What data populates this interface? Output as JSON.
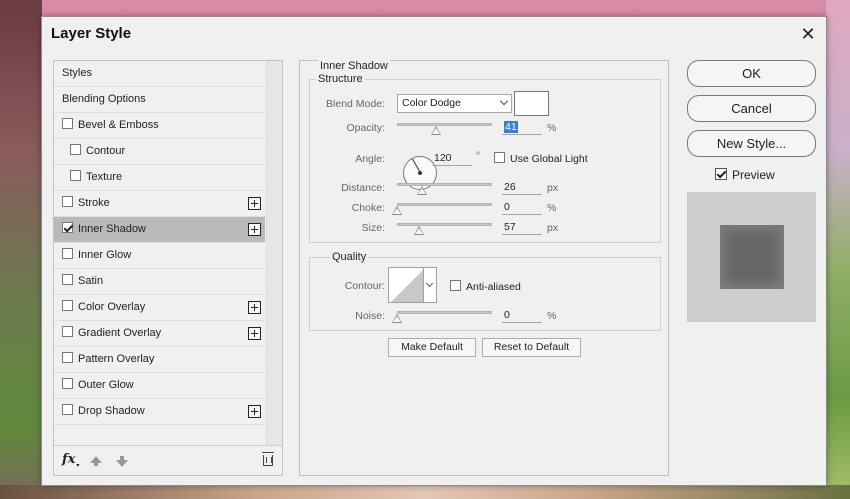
{
  "dialog": {
    "title": "Layer Style",
    "close_symbol": "✕"
  },
  "styles_panel": {
    "items": [
      {
        "label": "Styles",
        "checkbox": false
      },
      {
        "label": "Blending Options",
        "checkbox": false
      },
      {
        "label": "Bevel & Emboss",
        "checkbox": true,
        "checked": false
      },
      {
        "label": "Contour",
        "checkbox": true,
        "checked": false,
        "indent": true
      },
      {
        "label": "Texture",
        "checkbox": true,
        "checked": false,
        "indent": true
      },
      {
        "label": "Stroke",
        "checkbox": true,
        "checked": false,
        "plus": true
      },
      {
        "label": "Inner Shadow",
        "checkbox": true,
        "checked": true,
        "plus": true,
        "selected": true
      },
      {
        "label": "Inner Glow",
        "checkbox": true,
        "checked": false
      },
      {
        "label": "Satin",
        "checkbox": true,
        "checked": false
      },
      {
        "label": "Color Overlay",
        "checkbox": true,
        "checked": false,
        "plus": true
      },
      {
        "label": "Gradient Overlay",
        "checkbox": true,
        "checked": false,
        "plus": true
      },
      {
        "label": "Pattern Overlay",
        "checkbox": true,
        "checked": false
      },
      {
        "label": "Outer Glow",
        "checkbox": true,
        "checked": false
      },
      {
        "label": "Drop Shadow",
        "checkbox": true,
        "checked": false,
        "plus": true
      }
    ],
    "footer": {
      "fx_label": "fx"
    }
  },
  "inner_shadow": {
    "section_title": "Inner Shadow",
    "structure": {
      "title": "Structure",
      "blend_mode_label": "Blend Mode:",
      "blend_mode_value": "Color Dodge",
      "swatch_color": "#ffffff",
      "opacity_label": "Opacity:",
      "opacity_value": "41",
      "opacity_fraction": 0.41,
      "angle_label": "Angle:",
      "angle_value": "120",
      "angle_unit": "°",
      "use_global_light_label": "Use Global Light",
      "use_global_light": false,
      "distance_label": "Distance:",
      "distance_value": "26",
      "distance_fraction": 0.26,
      "choke_label": "Choke:",
      "choke_value": "0",
      "choke_fraction": 0.0,
      "size_label": "Size:",
      "size_value": "57",
      "size_fraction": 0.23,
      "unit_percent": "%",
      "unit_px": "px"
    },
    "quality": {
      "title": "Quality",
      "contour_label": "Contour:",
      "anti_aliased_label": "Anti-aliased",
      "anti_aliased": false,
      "noise_label": "Noise:",
      "noise_value": "0",
      "noise_fraction": 0.0,
      "unit_percent": "%"
    },
    "make_default_label": "Make Default",
    "reset_default_label": "Reset to Default"
  },
  "right_panel": {
    "ok_label": "OK",
    "cancel_label": "Cancel",
    "new_style_label": "New Style...",
    "preview_label": "Preview",
    "preview_checked": true
  }
}
